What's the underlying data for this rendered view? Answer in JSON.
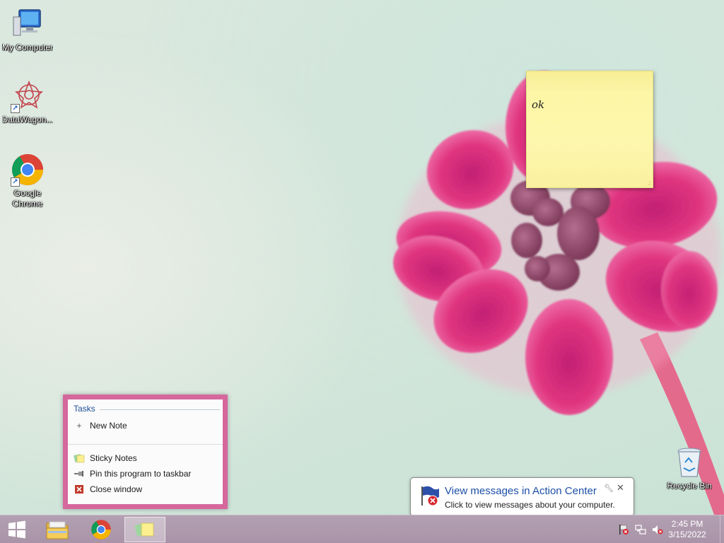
{
  "desktop": {
    "icons": [
      {
        "name": "my-computer",
        "label": "My Computer"
      },
      {
        "name": "datawagon",
        "label": "DataWagon..."
      },
      {
        "name": "google-chrome",
        "label": "Google Chrome"
      },
      {
        "name": "recycle-bin",
        "label": "Recycle Bin"
      }
    ]
  },
  "sticky_note": {
    "text": "ok"
  },
  "jump_list": {
    "header": "Tasks",
    "tasks": [
      {
        "label": "New Note",
        "icon": "plus-icon"
      }
    ],
    "actions": [
      {
        "label": "Sticky Notes",
        "icon": "sticky-notes-icon"
      },
      {
        "label": "Pin this program to taskbar",
        "icon": "pin-icon"
      },
      {
        "label": "Close window",
        "icon": "close-window-icon"
      }
    ]
  },
  "balloon": {
    "title": "View messages in Action Center",
    "body": "Click to view messages about your computer."
  },
  "taskbar": {
    "apps": [
      "start-button",
      "file-explorer",
      "google-chrome",
      "sticky-notes"
    ],
    "clock": {
      "time": "2:45 PM",
      "date": "3/15/2022"
    }
  },
  "colors": {
    "jump_list_frame": "#d5679c",
    "taskbar": "#ab95aa",
    "sticky_note": "#fdf6a3",
    "balloon_title": "#1c4fa5"
  }
}
